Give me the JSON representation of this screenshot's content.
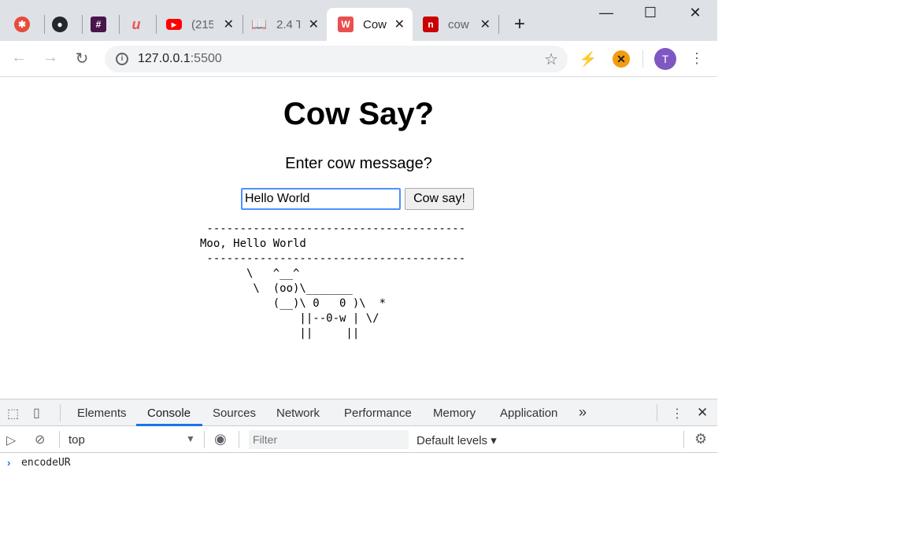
{
  "browser": {
    "tabs": [
      {
        "title": "",
        "favicon": "pinwheel-icon"
      },
      {
        "title": "",
        "favicon": "github-icon"
      },
      {
        "title": "",
        "favicon": "slack-icon"
      },
      {
        "title": "",
        "favicon": "udemy-icon"
      },
      {
        "title": "(215",
        "favicon": "youtube-icon"
      },
      {
        "title": "2.4 T",
        "favicon": "book-icon"
      },
      {
        "title": "Cow",
        "favicon": "w-icon",
        "active": true
      },
      {
        "title": "cow",
        "favicon": "npm-icon"
      }
    ],
    "new_tab": "+",
    "window_controls": {
      "minimize": "—",
      "maximize": "☐",
      "close": "✕"
    },
    "url": {
      "host": "127.0.0.1",
      "port": ":5500"
    },
    "avatar_letter": "T",
    "colors": {
      "accent": "#1a73e8",
      "avatar": "#7e57c2",
      "tabstrip": "#dee1e6"
    }
  },
  "page": {
    "title": "Cow Say?",
    "prompt": "Enter cow message?",
    "input_value": "Hello World",
    "button_label": "Cow say!",
    "output": " ---------------------------------------\nMoo, Hello World\n ---------------------------------------\n       \\   ^__^\n        \\  (oo)\\_______\n           (__)\\ 0   0 )\\  *\n               ||--0-w | \\/\n               ||     ||"
  },
  "devtools": {
    "tabs": [
      "Elements",
      "Console",
      "Sources",
      "Network",
      "Performance",
      "Memory",
      "Application"
    ],
    "more": "»",
    "context": "top",
    "filter_placeholder": "Filter",
    "levels": "Default levels ▾",
    "console_prompt": "›",
    "console_input": "encodeUR"
  }
}
